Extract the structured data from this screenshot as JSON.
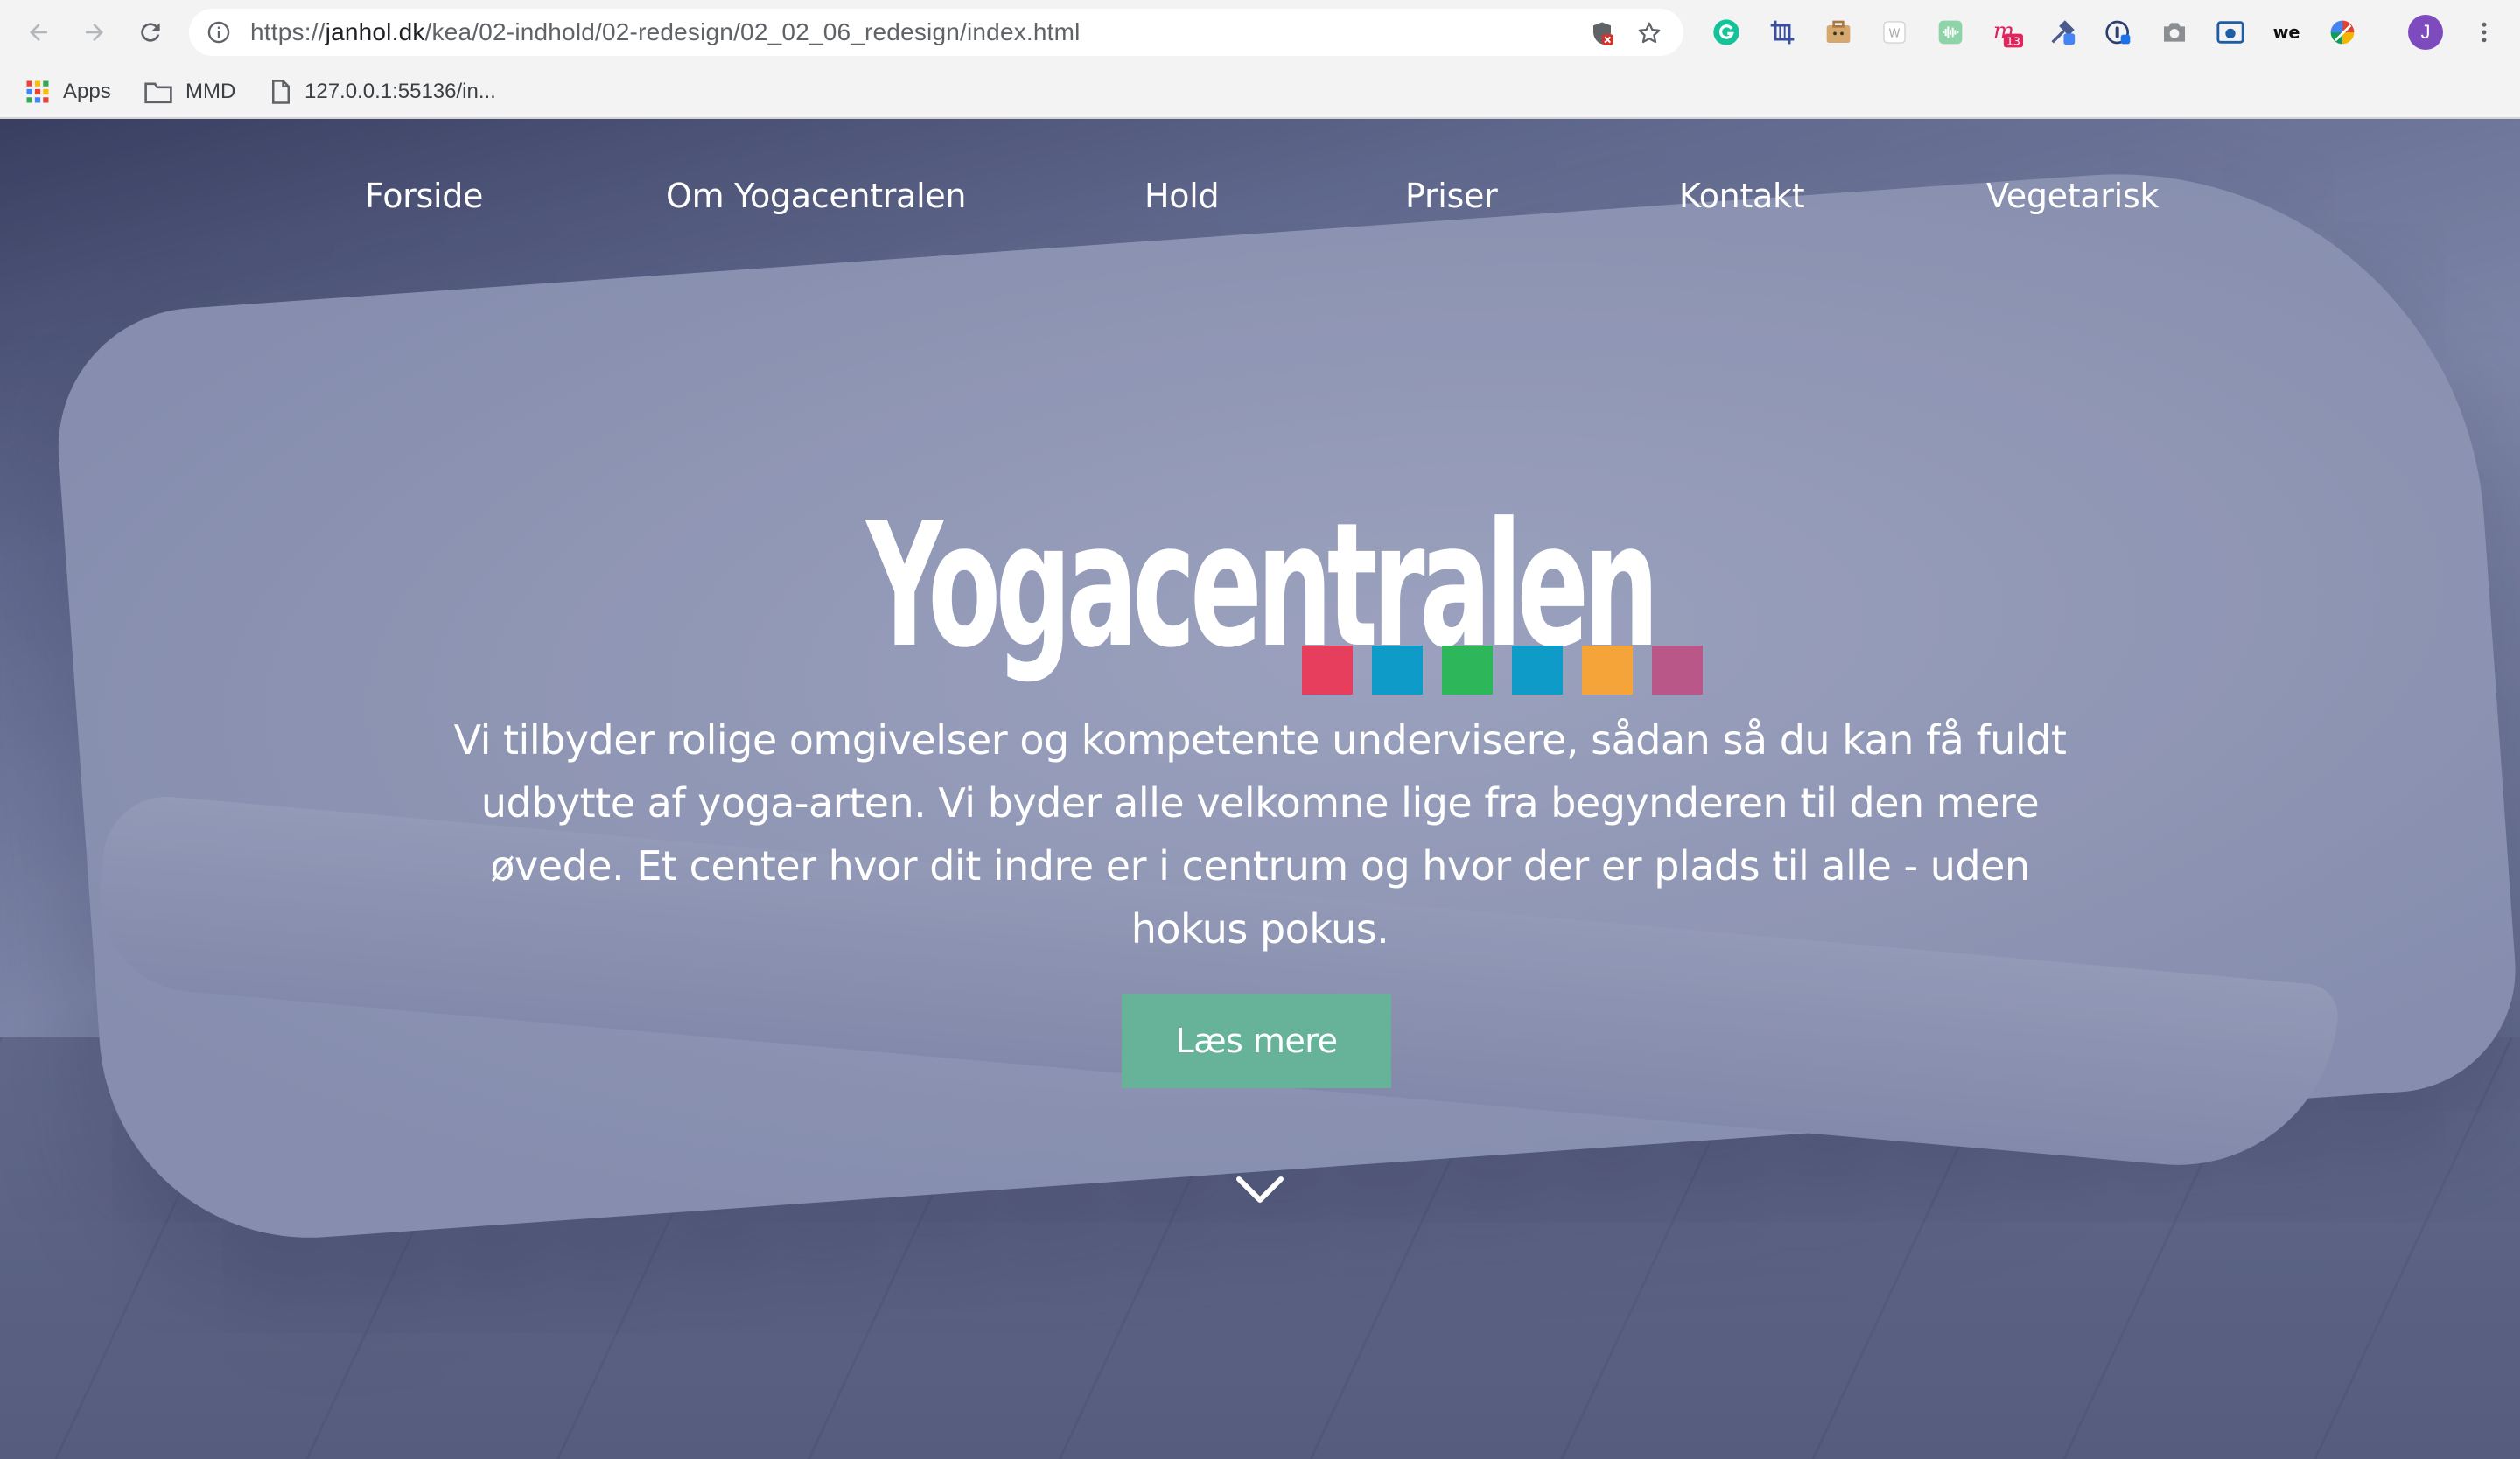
{
  "browser": {
    "url_prefix": "https://",
    "url_domain": "janhol.dk",
    "url_path": "/kea/02-indhold/02-redesign/02_02_06_redesign/index.html",
    "profile_initial": "J",
    "ext_badge": "13",
    "bookmarks": [
      {
        "label": "Apps"
      },
      {
        "label": "MMD"
      },
      {
        "label": "127.0.0.1:55136/in..."
      }
    ]
  },
  "nav": {
    "items": [
      "Forside",
      "Om Yogacentralen",
      "Hold",
      "Priser",
      "Kontakt",
      "Vegetarisk"
    ]
  },
  "hero": {
    "title": "Yogacentralen",
    "description": "Vi tilbyder rolige omgivelser og kompetente undervisere, sådan så du kan få fuldt udbytte af yoga-arten. Vi byder alle velkomne lige fra begynderen til den mere øvede. Et center hvor dit indre er i centrum og hvor der er plads til alle - uden hokus pokus.",
    "cta_label": "Læs mere",
    "square_colors": [
      "#e83e5e",
      "#0e9bc7",
      "#2db65a",
      "#0e9bc7",
      "#f5a43a",
      "#b95788"
    ],
    "cta_color": "#66b39a",
    "scroll_icon": "chevron-down-icon"
  }
}
